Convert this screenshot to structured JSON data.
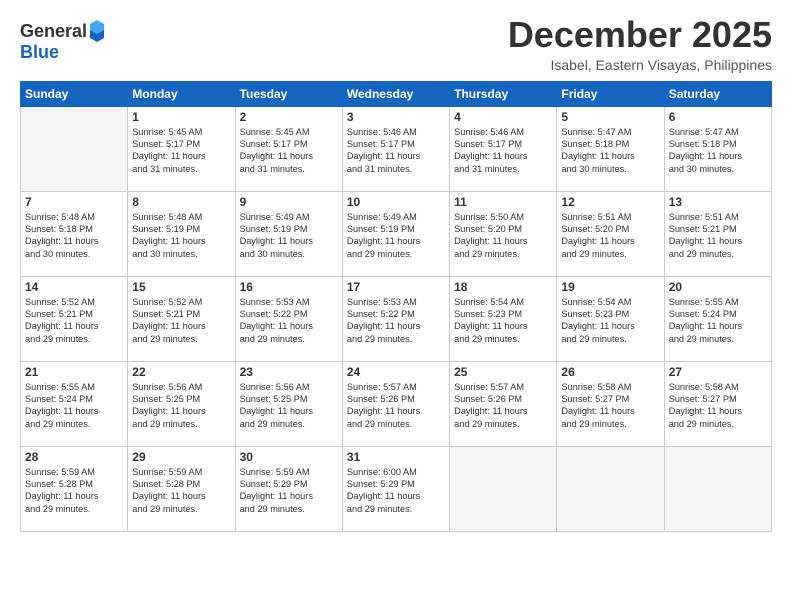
{
  "header": {
    "logo_line1": "General",
    "logo_line2": "Blue",
    "month": "December 2025",
    "location": "Isabel, Eastern Visayas, Philippines"
  },
  "weekdays": [
    "Sunday",
    "Monday",
    "Tuesday",
    "Wednesday",
    "Thursday",
    "Friday",
    "Saturday"
  ],
  "weeks": [
    [
      {
        "day": "",
        "info": ""
      },
      {
        "day": "1",
        "info": "Sunrise: 5:45 AM\nSunset: 5:17 PM\nDaylight: 11 hours\nand 31 minutes."
      },
      {
        "day": "2",
        "info": "Sunrise: 5:45 AM\nSunset: 5:17 PM\nDaylight: 11 hours\nand 31 minutes."
      },
      {
        "day": "3",
        "info": "Sunrise: 5:46 AM\nSunset: 5:17 PM\nDaylight: 11 hours\nand 31 minutes."
      },
      {
        "day": "4",
        "info": "Sunrise: 5:46 AM\nSunset: 5:17 PM\nDaylight: 11 hours\nand 31 minutes."
      },
      {
        "day": "5",
        "info": "Sunrise: 5:47 AM\nSunset: 5:18 PM\nDaylight: 11 hours\nand 30 minutes."
      },
      {
        "day": "6",
        "info": "Sunrise: 5:47 AM\nSunset: 5:18 PM\nDaylight: 11 hours\nand 30 minutes."
      }
    ],
    [
      {
        "day": "7",
        "info": "Sunrise: 5:48 AM\nSunset: 5:18 PM\nDaylight: 11 hours\nand 30 minutes."
      },
      {
        "day": "8",
        "info": "Sunrise: 5:48 AM\nSunset: 5:19 PM\nDaylight: 11 hours\nand 30 minutes."
      },
      {
        "day": "9",
        "info": "Sunrise: 5:49 AM\nSunset: 5:19 PM\nDaylight: 11 hours\nand 30 minutes."
      },
      {
        "day": "10",
        "info": "Sunrise: 5:49 AM\nSunset: 5:19 PM\nDaylight: 11 hours\nand 29 minutes."
      },
      {
        "day": "11",
        "info": "Sunrise: 5:50 AM\nSunset: 5:20 PM\nDaylight: 11 hours\nand 29 minutes."
      },
      {
        "day": "12",
        "info": "Sunrise: 5:51 AM\nSunset: 5:20 PM\nDaylight: 11 hours\nand 29 minutes."
      },
      {
        "day": "13",
        "info": "Sunrise: 5:51 AM\nSunset: 5:21 PM\nDaylight: 11 hours\nand 29 minutes."
      }
    ],
    [
      {
        "day": "14",
        "info": "Sunrise: 5:52 AM\nSunset: 5:21 PM\nDaylight: 11 hours\nand 29 minutes."
      },
      {
        "day": "15",
        "info": "Sunrise: 5:52 AM\nSunset: 5:21 PM\nDaylight: 11 hours\nand 29 minutes."
      },
      {
        "day": "16",
        "info": "Sunrise: 5:53 AM\nSunset: 5:22 PM\nDaylight: 11 hours\nand 29 minutes."
      },
      {
        "day": "17",
        "info": "Sunrise: 5:53 AM\nSunset: 5:22 PM\nDaylight: 11 hours\nand 29 minutes."
      },
      {
        "day": "18",
        "info": "Sunrise: 5:54 AM\nSunset: 5:23 PM\nDaylight: 11 hours\nand 29 minutes."
      },
      {
        "day": "19",
        "info": "Sunrise: 5:54 AM\nSunset: 5:23 PM\nDaylight: 11 hours\nand 29 minutes."
      },
      {
        "day": "20",
        "info": "Sunrise: 5:55 AM\nSunset: 5:24 PM\nDaylight: 11 hours\nand 29 minutes."
      }
    ],
    [
      {
        "day": "21",
        "info": "Sunrise: 5:55 AM\nSunset: 5:24 PM\nDaylight: 11 hours\nand 29 minutes."
      },
      {
        "day": "22",
        "info": "Sunrise: 5:56 AM\nSunset: 5:25 PM\nDaylight: 11 hours\nand 29 minutes."
      },
      {
        "day": "23",
        "info": "Sunrise: 5:56 AM\nSunset: 5:25 PM\nDaylight: 11 hours\nand 29 minutes."
      },
      {
        "day": "24",
        "info": "Sunrise: 5:57 AM\nSunset: 5:26 PM\nDaylight: 11 hours\nand 29 minutes."
      },
      {
        "day": "25",
        "info": "Sunrise: 5:57 AM\nSunset: 5:26 PM\nDaylight: 11 hours\nand 29 minutes."
      },
      {
        "day": "26",
        "info": "Sunrise: 5:58 AM\nSunset: 5:27 PM\nDaylight: 11 hours\nand 29 minutes."
      },
      {
        "day": "27",
        "info": "Sunrise: 5:58 AM\nSunset: 5:27 PM\nDaylight: 11 hours\nand 29 minutes."
      }
    ],
    [
      {
        "day": "28",
        "info": "Sunrise: 5:59 AM\nSunset: 5:28 PM\nDaylight: 11 hours\nand 29 minutes."
      },
      {
        "day": "29",
        "info": "Sunrise: 5:59 AM\nSunset: 5:28 PM\nDaylight: 11 hours\nand 29 minutes."
      },
      {
        "day": "30",
        "info": "Sunrise: 5:59 AM\nSunset: 5:29 PM\nDaylight: 11 hours\nand 29 minutes."
      },
      {
        "day": "31",
        "info": "Sunrise: 6:00 AM\nSunset: 5:29 PM\nDaylight: 11 hours\nand 29 minutes."
      },
      {
        "day": "",
        "info": ""
      },
      {
        "day": "",
        "info": ""
      },
      {
        "day": "",
        "info": ""
      }
    ]
  ]
}
